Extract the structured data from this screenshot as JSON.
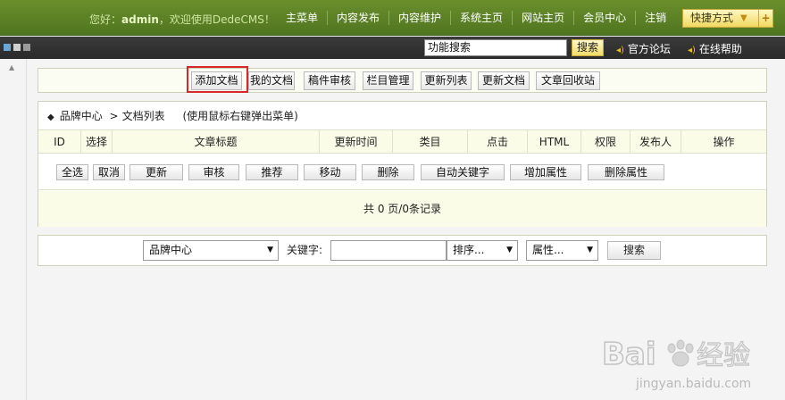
{
  "header": {
    "greeting_prefix": "您好：",
    "username": "admin",
    "greeting_suffix": "，欢迎使用DedeCMS！",
    "nav": [
      "主菜单",
      "内容发布",
      "内容维护",
      "系统主页",
      "网站主页",
      "会员中心",
      "注销"
    ],
    "quick_label": "快捷方式"
  },
  "subbar": {
    "search_value": "功能搜索",
    "search_button": "搜索",
    "forum_link": "官方论坛",
    "help_link": "在线帮助"
  },
  "toolbar": {
    "buttons": [
      "添加文档",
      "我的文档",
      "稿件审核",
      "栏目管理",
      "更新列表",
      "更新文档",
      "文章回收站"
    ]
  },
  "list": {
    "breadcrumb_root": "品牌中心",
    "breadcrumb_sep": ">",
    "breadcrumb_current": "文档列表",
    "hint": "(使用鼠标右键弹出菜单)",
    "columns": [
      "ID",
      "选择",
      "文章标题",
      "更新时间",
      "类目",
      "点击",
      "HTML",
      "权限",
      "发布人",
      "操作"
    ],
    "actions": [
      "全选",
      "取消",
      "更新",
      "审核",
      "推荐",
      "移动",
      "删除",
      "自动关键字",
      "增加属性",
      "删除属性"
    ],
    "pager_text": "共 0 页/0条记录"
  },
  "search": {
    "category": "品牌中心",
    "keyword_label": "关键字:",
    "keyword_value": "",
    "sort_label": "排序...",
    "attr_label": "属性...",
    "submit": "搜索"
  },
  "watermark": {
    "brand": "Baidu经验",
    "url": "jingyan.baidu.com"
  },
  "colors": {
    "top_bar": "#5a8226",
    "dark_bar": "#333333",
    "highlight": "#d8282a",
    "table_header_bg": "#fbfce8"
  }
}
